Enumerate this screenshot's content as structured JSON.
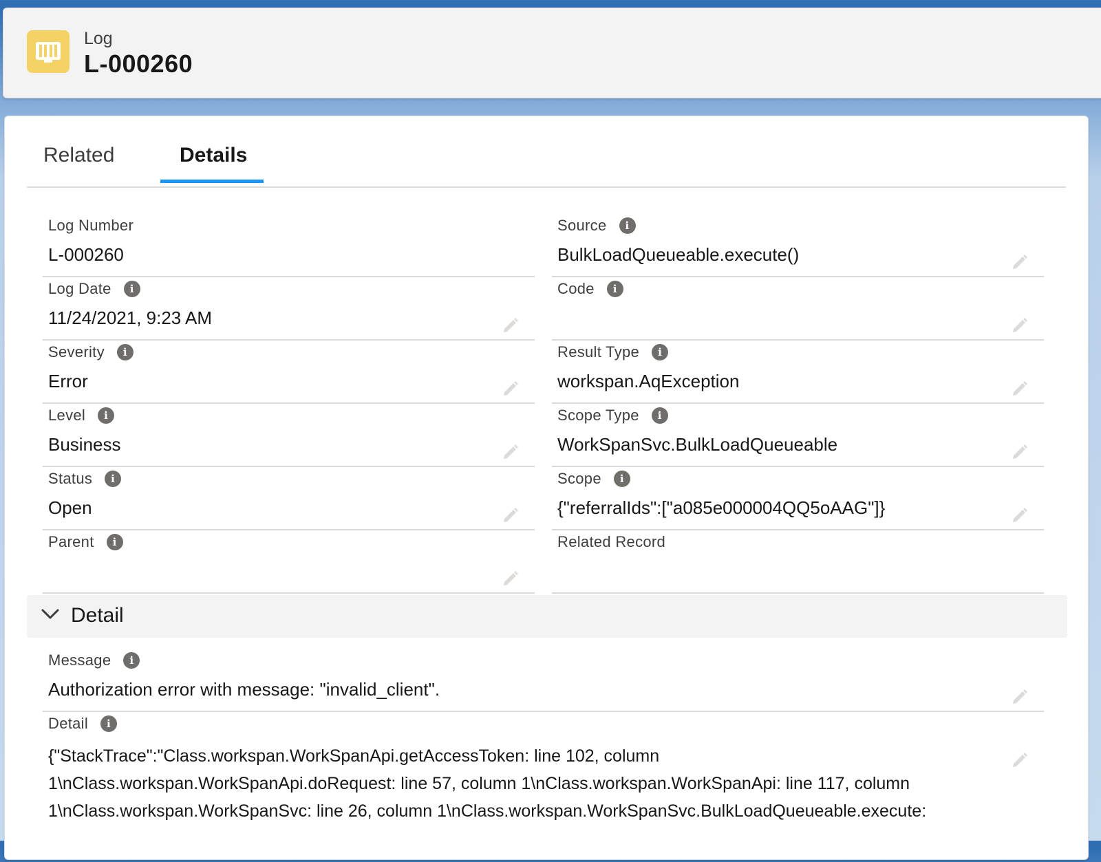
{
  "header": {
    "object_label": "Log",
    "record_name": "L-000260"
  },
  "tabs": [
    {
      "label": "Related",
      "active": false
    },
    {
      "label": "Details",
      "active": true
    }
  ],
  "fields": {
    "log_number": {
      "label": "Log Number",
      "value": "L-000260"
    },
    "source": {
      "label": "Source",
      "value": "BulkLoadQueueable.execute()"
    },
    "log_date": {
      "label": "Log Date",
      "value": "11/24/2021, 9:23 AM"
    },
    "code": {
      "label": "Code",
      "value": ""
    },
    "severity": {
      "label": "Severity",
      "value": "Error"
    },
    "result_type": {
      "label": "Result Type",
      "value": "workspan.AqException"
    },
    "level": {
      "label": "Level",
      "value": "Business"
    },
    "scope_type": {
      "label": "Scope Type",
      "value": "WorkSpanSvc.BulkLoadQueueable"
    },
    "status": {
      "label": "Status",
      "value": "Open"
    },
    "scope": {
      "label": "Scope",
      "value": "{\"referralIds\":[\"a085e000004QQ5oAAG\"]}"
    },
    "parent": {
      "label": "Parent",
      "value": ""
    },
    "related_record": {
      "label": "Related Record",
      "value": ""
    }
  },
  "detail_section": {
    "title": "Detail",
    "message": {
      "label": "Message",
      "value": "Authorization error with message: \"invalid_client\"."
    },
    "detail": {
      "label": "Detail",
      "lines": [
        "{\"StackTrace\":\"Class.workspan.WorkSpanApi.getAccessToken: line 102, column",
        "1\\nClass.workspan.WorkSpanApi.doRequest: line 57, column 1\\nClass.workspan.WorkSpanApi: line 117, column",
        "1\\nClass.workspan.WorkSpanSvc: line 26, column 1\\nClass.workspan.WorkSpanSvc.BulkLoadQueueable.execute:"
      ]
    }
  },
  "colors": {
    "tab_active_underline": "#1b96ff",
    "object_icon_bg": "#f4d264",
    "info_icon": "#706e6b"
  },
  "icons": {
    "object": "book-icon",
    "info": "info-icon",
    "edit": "pencil-icon",
    "collapse": "chevron-down-icon"
  }
}
